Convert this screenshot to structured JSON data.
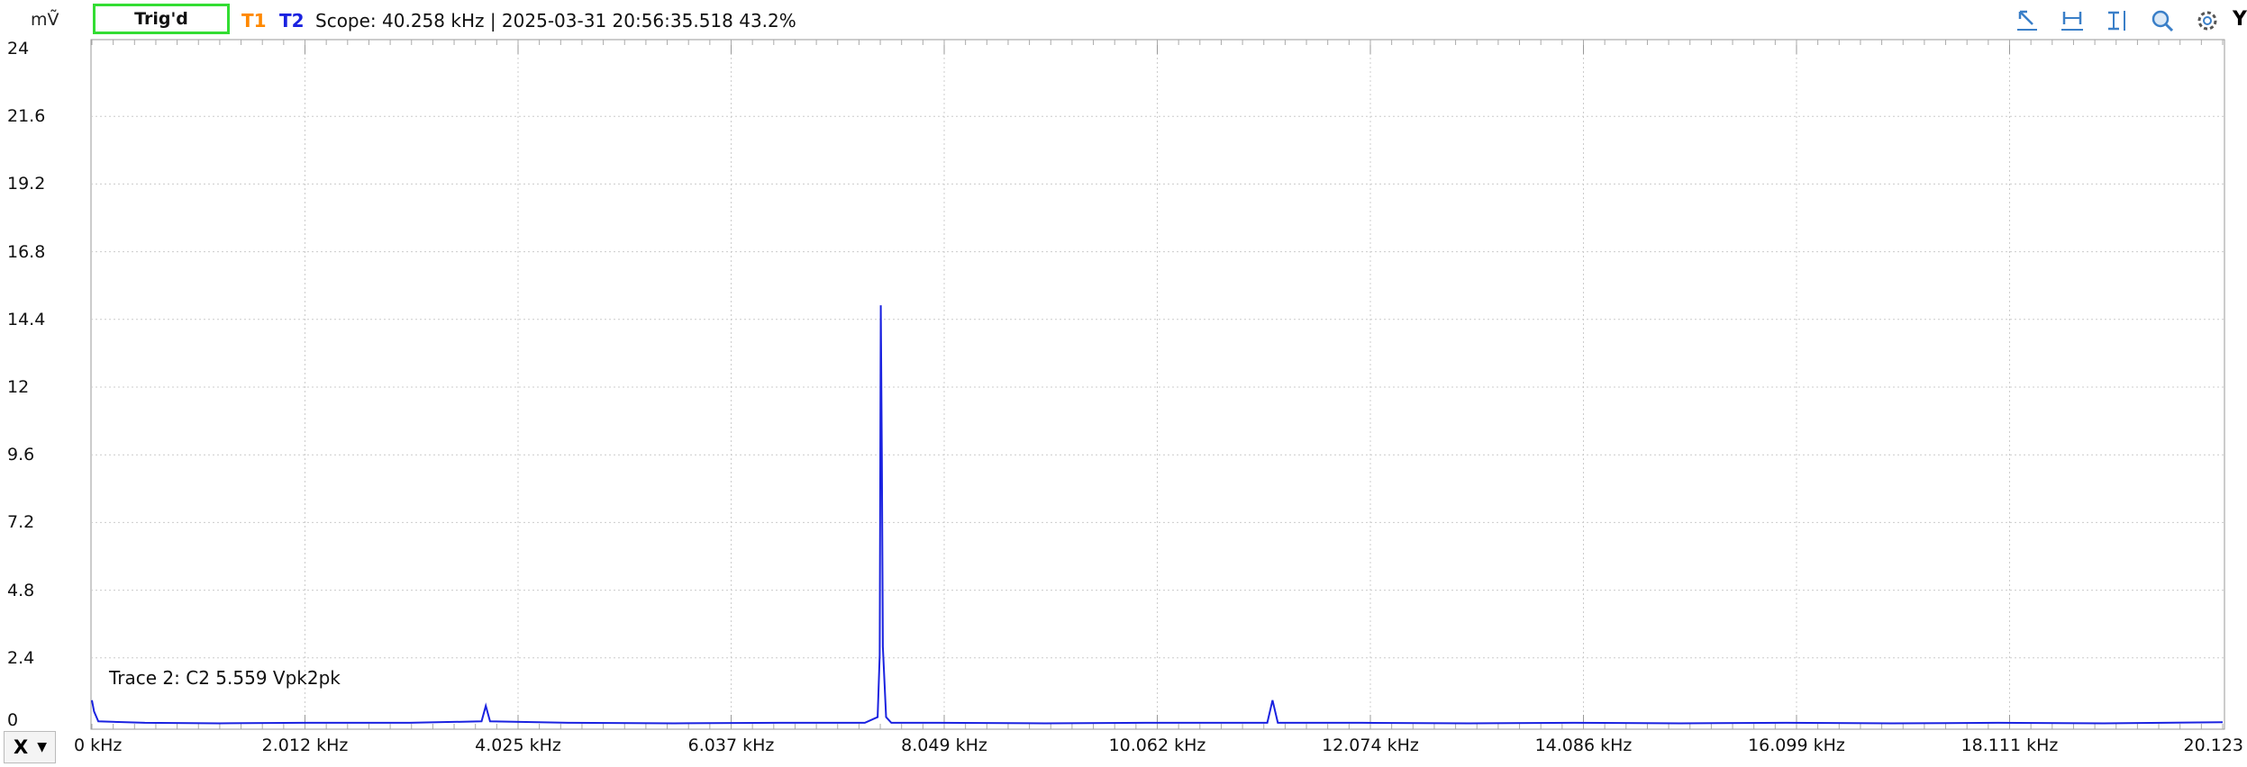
{
  "toolbar": {
    "unit": "mṼ",
    "trigger_status": "Trig'd",
    "trace1_label": "T1",
    "trace2_label": "T2",
    "scope_info": "Scope: 40.258 kHz | 2025-03-31 20:56:35.518 43.2%",
    "y_axis_button": "Y"
  },
  "x_axis_button": {
    "label": "X",
    "dropdown": "▼"
  },
  "annotation": "Trace 2: C2 5.559 Vpk2pk",
  "colors": {
    "trace2": "#1a22e0",
    "trace1": "#ff8800",
    "trigger_border": "#33dd33",
    "grid": "#cccccc",
    "icons": "#3a7fc8"
  },
  "icons": [
    "cursor-arrow-icon",
    "horizontal-measure-icon",
    "vertical-measure-icon",
    "zoom-icon",
    "settings-icon"
  ],
  "chart_data": {
    "type": "line",
    "title": "",
    "xlabel": "",
    "ylabel": "mṼ",
    "xlim": [
      0,
      20.123
    ],
    "ylim": [
      0,
      24
    ],
    "x_ticks": [
      "0 kHz",
      "2.012 kHz",
      "4.025 kHz",
      "6.037 kHz",
      "8.049 kHz",
      "10.062 kHz",
      "12.074 kHz",
      "14.086 kHz",
      "16.099 kHz",
      "18.111 kHz",
      "20.123"
    ],
    "y_ticks": [
      "24",
      "21.6",
      "19.2",
      "16.8",
      "14.4",
      "12",
      "9.6",
      "7.2",
      "4.8",
      "2.4",
      "0"
    ],
    "grid": true,
    "series": [
      {
        "name": "T2",
        "x": [
          0,
          0.02,
          0.06,
          0.5,
          1.2,
          2.0,
          3.0,
          3.68,
          3.72,
          3.76,
          4.5,
          5.5,
          6.5,
          7.3,
          7.42,
          7.44,
          7.45,
          7.46,
          7.47,
          7.5,
          7.55,
          8.0,
          9.0,
          10.0,
          11.1,
          11.15,
          11.2,
          12.0,
          13.0,
          14.0,
          15.0,
          16.0,
          17.0,
          18.0,
          19.0,
          20.123
        ],
        "y": [
          0.9,
          0.5,
          0.15,
          0.1,
          0.08,
          0.1,
          0.1,
          0.15,
          0.7,
          0.15,
          0.1,
          0.08,
          0.1,
          0.1,
          0.3,
          2.5,
          14.9,
          9.5,
          2.8,
          0.3,
          0.1,
          0.1,
          0.08,
          0.1,
          0.1,
          0.9,
          0.1,
          0.1,
          0.08,
          0.1,
          0.08,
          0.1,
          0.08,
          0.1,
          0.08,
          0.12
        ]
      }
    ]
  }
}
